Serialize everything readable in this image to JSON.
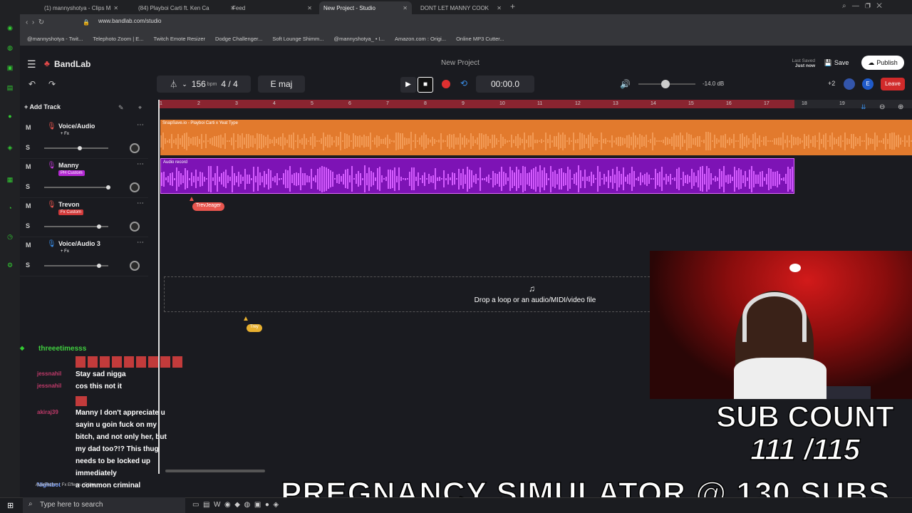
{
  "browser": {
    "tabs": [
      {
        "label": "(1) mannyshotya - Clips M",
        "active": false
      },
      {
        "label": "(84) Playboi Carti ft. Ken Ca",
        "active": false
      },
      {
        "label": "Feed",
        "active": false
      },
      {
        "label": "New Project - Studio",
        "active": true
      },
      {
        "label": "DONT LET MANNY COOK",
        "active": false
      }
    ],
    "url": "www.bandlab.com/studio",
    "bookmarks": [
      "@mannyshotya - Twit...",
      "Telephoto Zoom | E...",
      "Twitch Emote Resizer",
      "Dodge Challenger...",
      "Soft Lounge Shimm...",
      "@mannyshotya_ • I...",
      "Amazon.com : Origi...",
      "Online MP3 Cutter..."
    ]
  },
  "app": {
    "logo": "BandLab",
    "project_title": "New Project",
    "last_saved_label": "Last Saved",
    "last_saved_value": "Just now",
    "save_label": "Save",
    "publish_label": "Publish",
    "leave_label": "Leave",
    "collab_count": "+2",
    "bpm": "156",
    "bpm_unit": "bpm",
    "time_sig": "4 / 4",
    "key": "E maj",
    "time": "00:00.0",
    "volume_db": "-14.0 dB",
    "volume_level": 0.18,
    "add_track_label": "Add Track",
    "ruler_ticks": [
      "1",
      "2",
      "3",
      "4",
      "5",
      "6",
      "7",
      "8",
      "9",
      "10",
      "11",
      "12",
      "13",
      "14",
      "15",
      "16",
      "17",
      "18",
      "19"
    ],
    "tracks": [
      {
        "name": "Voice/Audio",
        "fx": "+ Fx",
        "fx_color": "",
        "icon_color": "#e8554e",
        "vol": 0.55
      },
      {
        "name": "Manny",
        "fx": "PH Custom",
        "fx_color": "#b52ad4",
        "icon_color": "#c43ad8",
        "vol": 1.0
      },
      {
        "name": "Trevon",
        "fx": "Fx Custom",
        "fx_color": "#d23a3a",
        "icon_color": "#e8554e",
        "vol": 0.85
      },
      {
        "name": "Voice/Audio 3",
        "fx": "+ Fx",
        "fx_color": "",
        "icon_color": "#3a8ee8",
        "vol": 0.85
      }
    ],
    "mute_label": "M",
    "solo_label": "S",
    "region1_label": "SnapSave.io - Playboi Carti x Yeat Type",
    "region2_label": "Audio record",
    "cursor_tag_1": "TrevJeager",
    "cursor_tag_2": "Trey",
    "drop_text": "Drop a loop or an audio/MIDI/video file",
    "lane1_color": "#e27a2d",
    "lane2_color": "#7d13b5"
  },
  "chat": {
    "top_user": "threeetimesss",
    "lines": [
      {
        "user": "jessnahil",
        "text": "Stay sad nigga"
      },
      {
        "user": "jessnahil",
        "text": "cos this not it"
      },
      {
        "user": "akiraj39",
        "text": "Manny I don't appreciate u"
      },
      {
        "user": "",
        "text": "sayin u goin fuck on my"
      },
      {
        "user": "",
        "text": "bitch, and not only her, but"
      },
      {
        "user": "",
        "text": "my dad too?!? This thug"
      },
      {
        "user": "",
        "text": "needs to be locked up"
      },
      {
        "user": "",
        "text": "immediately"
      },
      {
        "user": "Nightbot",
        "text": "a common criminal"
      }
    ]
  },
  "overlay": {
    "sub_line1": "SUB COUNT",
    "sub_line2": "111 /115",
    "banner": "PREGNANCY SIMULATOR @ 130 SUBS"
  },
  "taskbar": {
    "search_placeholder": "Type here to search"
  },
  "bottom_labels": {
    "autopitch": "AutoPitch™",
    "fx": "Fx Effects",
    "editor": "Editor"
  }
}
